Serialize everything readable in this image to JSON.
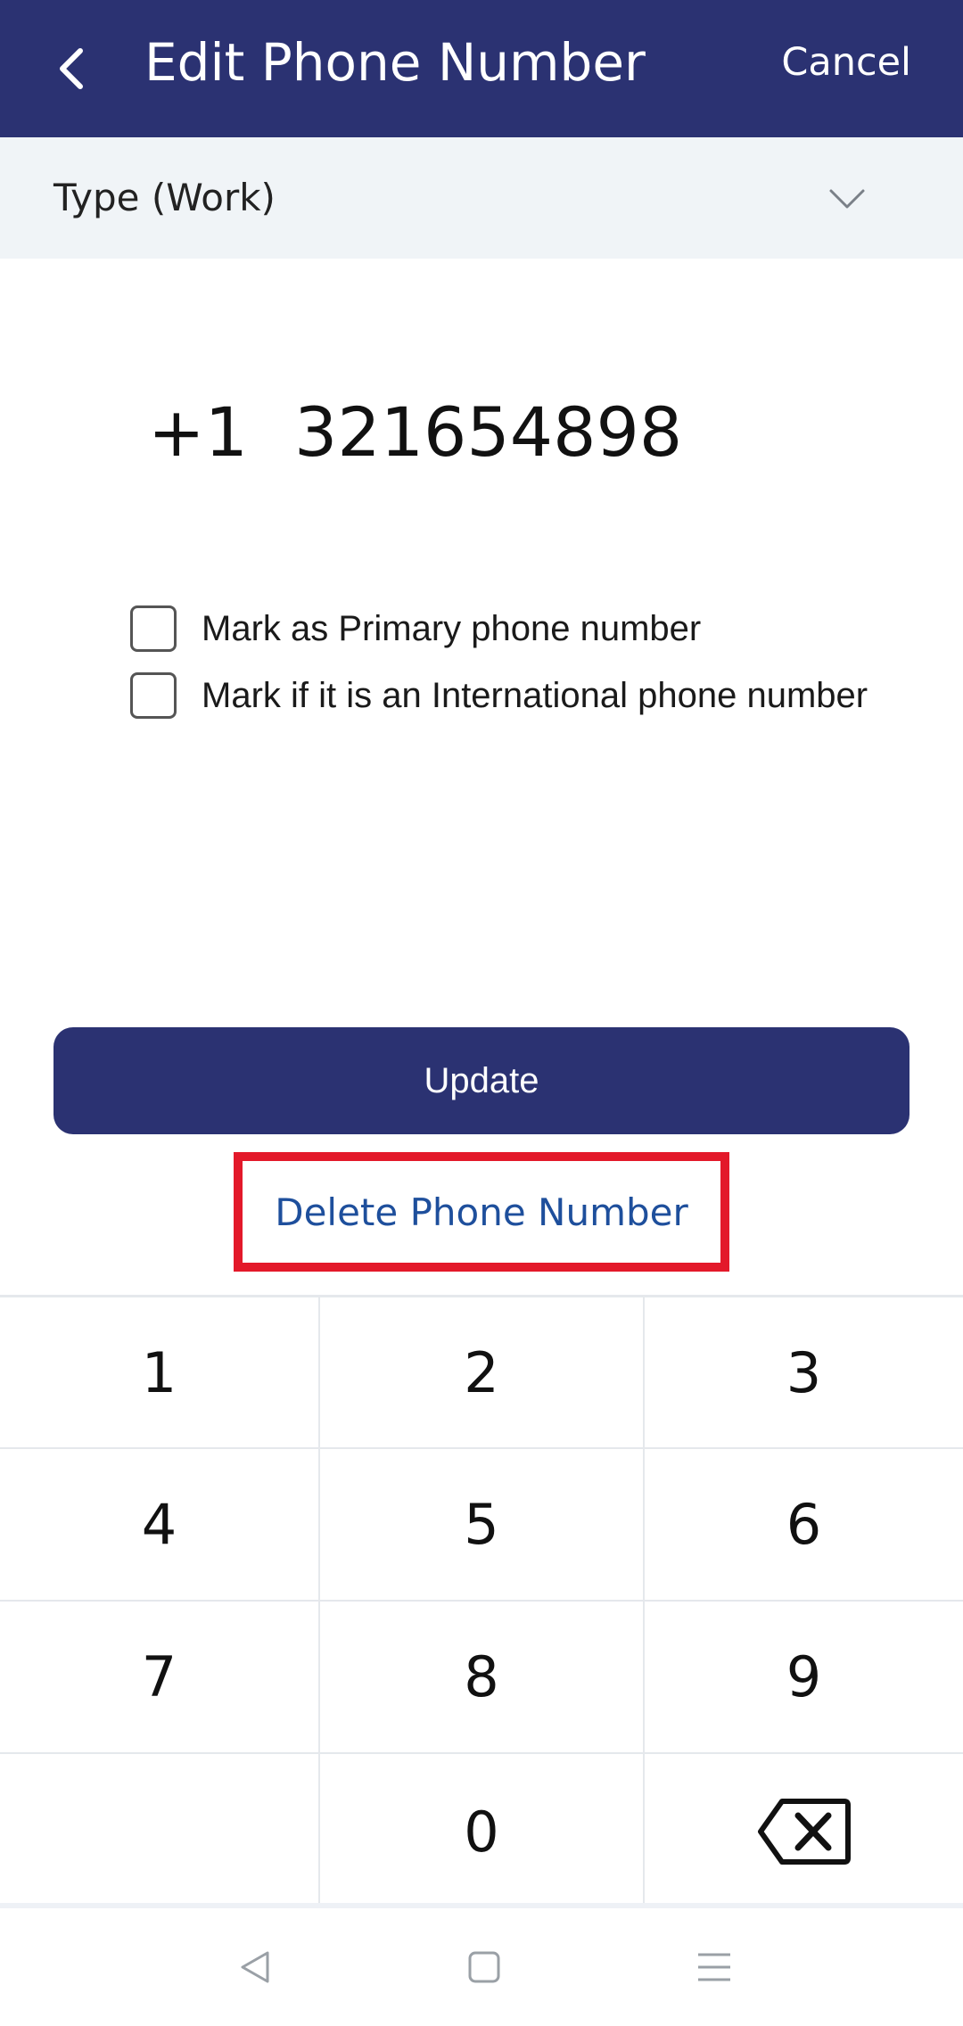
{
  "header": {
    "back_icon": "chevron-left-icon",
    "title": "Edit Phone Number",
    "cancel_label": "Cancel"
  },
  "type_selector": {
    "label": "Type (Work)",
    "icon": "chevron-down-icon"
  },
  "phone": {
    "country_code": "+1",
    "number": "321654898"
  },
  "options": [
    {
      "label": "Mark as Primary phone number",
      "checked": false
    },
    {
      "label": "Mark if it is an International phone number",
      "checked": false
    }
  ],
  "actions": {
    "update_label": "Update",
    "delete_label": "Delete Phone Number"
  },
  "keypad": {
    "keys": [
      "1",
      "2",
      "3",
      "4",
      "5",
      "6",
      "7",
      "8",
      "9",
      "",
      "0",
      "backspace-icon"
    ]
  },
  "navbar": {
    "icons": [
      "nav-back-icon",
      "nav-home-icon",
      "nav-menu-icon"
    ]
  },
  "colors": {
    "primary": "#2b3272",
    "link": "#1e4f9c",
    "highlight": "#e3192a",
    "surface": "#f0f4f7"
  }
}
